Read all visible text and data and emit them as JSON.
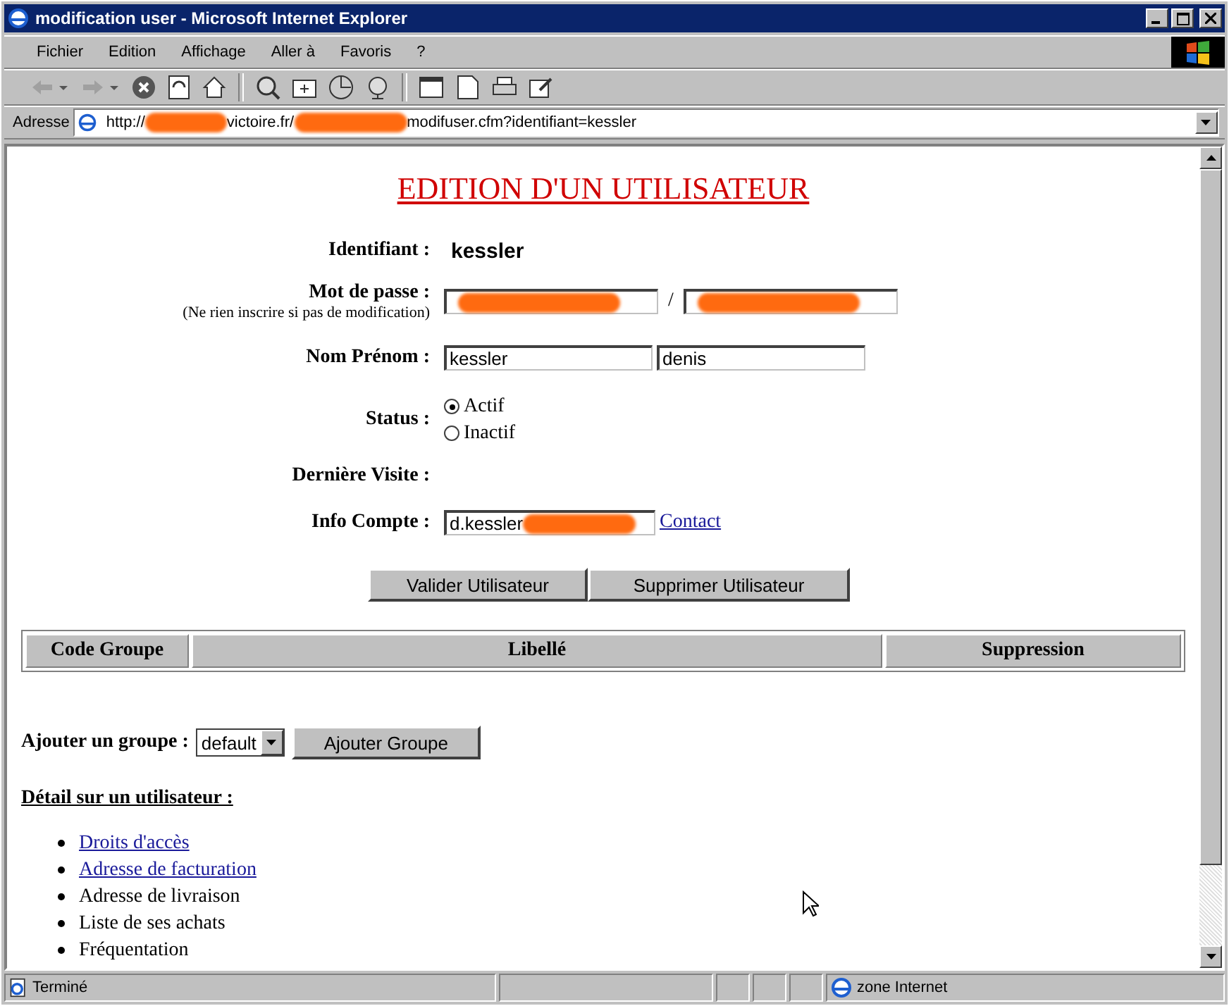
{
  "window": {
    "title": "modification user - Microsoft Internet Explorer"
  },
  "menu": [
    "Fichier",
    "Edition",
    "Affichage",
    "Aller à",
    "Favoris",
    "?"
  ],
  "address": {
    "label": "Adresse",
    "url_parts": [
      "http://",
      "victoire.fr/",
      "modifuser.cfm?identifiant=kessler"
    ]
  },
  "page": {
    "heading": "EDITION D'UN UTILISATEUR",
    "identifiant": {
      "label": "Identifiant :",
      "value": "kessler"
    },
    "password": {
      "label": "Mot de passe :",
      "hint": "(Ne rien inscrire si pas de modification)",
      "separator": "/"
    },
    "name": {
      "label": "Nom Prénom :",
      "last": "kessler",
      "first": "denis"
    },
    "status": {
      "label": "Status :",
      "options": [
        {
          "label": "Actif",
          "selected": true
        },
        {
          "label": "Inactif",
          "selected": false
        }
      ]
    },
    "last_visit": {
      "label": "Dernière Visite :"
    },
    "account": {
      "label": "Info Compte :",
      "value": "d.kessler",
      "link": "Contact"
    },
    "buttons": [
      "Valider Utilisateur",
      "Supprimer Utilisateur"
    ],
    "table": {
      "columns": [
        "Code Groupe",
        "Libellé",
        "Suppression"
      ]
    },
    "add_group": {
      "label": "Ajouter un groupe :",
      "select": "default",
      "button": "Ajouter Groupe"
    },
    "detail": {
      "heading": "Détail sur un utilisateur :",
      "items": [
        {
          "label": "Droits d'accès",
          "link": true
        },
        {
          "label": "Adresse de facturation",
          "link": true
        },
        {
          "label": "Adresse de livraison",
          "link": false
        },
        {
          "label": "Liste de ses achats",
          "link": false
        },
        {
          "label": "Fréquentation",
          "link": false
        }
      ]
    }
  },
  "status_bar": {
    "text": "Terminé",
    "zone": "zone Internet"
  }
}
